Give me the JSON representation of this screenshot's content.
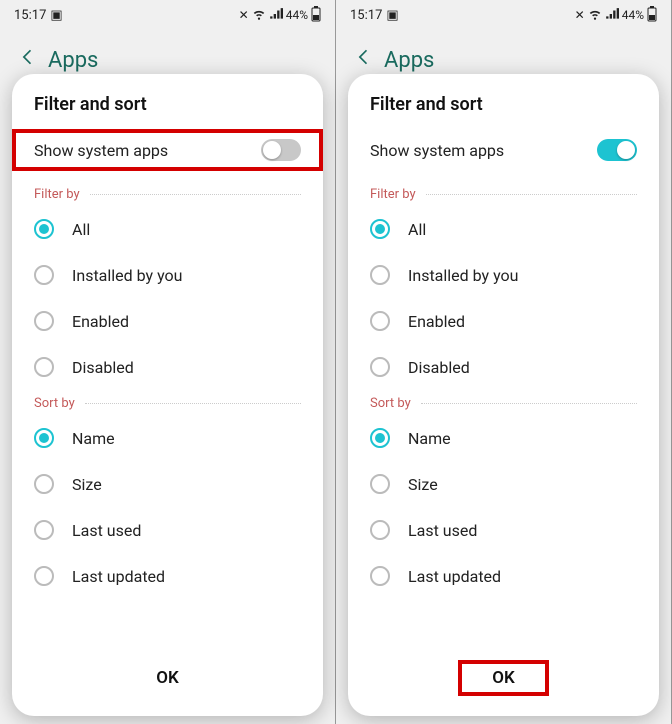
{
  "status": {
    "time": "15:17",
    "battery_text": "44%"
  },
  "bg_header": {
    "title": "Apps"
  },
  "dialog": {
    "title": "Filter and sort",
    "toggle_label": "Show system apps",
    "filter_label": "Filter by",
    "sort_label": "Sort by",
    "ok_label": "OK",
    "filter_options": [
      {
        "label": "All",
        "selected": true
      },
      {
        "label": "Installed by you",
        "selected": false
      },
      {
        "label": "Enabled",
        "selected": false
      },
      {
        "label": "Disabled",
        "selected": false
      }
    ],
    "sort_options": [
      {
        "label": "Name",
        "selected": true
      },
      {
        "label": "Size",
        "selected": false
      },
      {
        "label": "Last used",
        "selected": false
      },
      {
        "label": "Last updated",
        "selected": false
      }
    ]
  },
  "panes": [
    {
      "toggle_on": false,
      "highlight": "toggle"
    },
    {
      "toggle_on": true,
      "highlight": "ok"
    }
  ],
  "colors": {
    "accent": "#1dc3d1",
    "red": "#d40000",
    "section_label": "#c45a5a"
  }
}
